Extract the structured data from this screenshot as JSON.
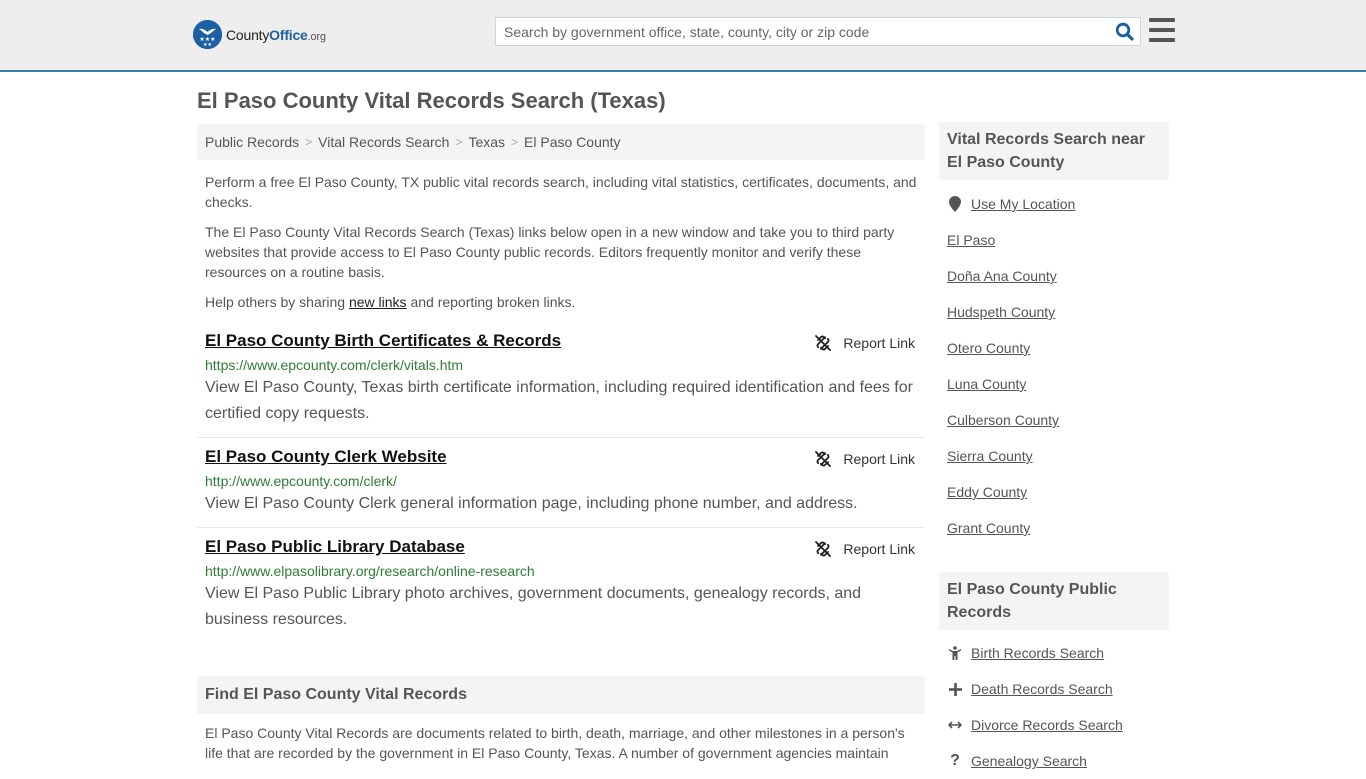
{
  "header": {
    "logo": {
      "brand_prefix": "County",
      "brand_main": "Office",
      "brand_suffix": ".org"
    },
    "search": {
      "placeholder": "Search by government office, state, county, city or zip code",
      "value": ""
    },
    "accent_color": "#3a7bb0"
  },
  "page": {
    "title": "El Paso County Vital Records Search (Texas)"
  },
  "breadcrumb": [
    {
      "label": "Public Records"
    },
    {
      "label": "Vital Records Search"
    },
    {
      "label": "Texas"
    },
    {
      "label": "El Paso County"
    }
  ],
  "intro": {
    "p1": "Perform a free El Paso County, TX public vital records search, including vital statistics, certificates, documents, and checks.",
    "p2": "The El Paso County Vital Records Search (Texas) links below open in a new window and take you to third party websites that provide access to El Paso County public records. Editors frequently monitor and verify these resources on a routine basis.",
    "p3_before": "Help others by sharing ",
    "p3_link": "new links",
    "p3_after": " and reporting broken links."
  },
  "results": [
    {
      "title": "El Paso County Birth Certificates & Records",
      "url": "https://www.epcounty.com/clerk/vitals.htm",
      "description": "View El Paso County, Texas birth certificate information, including required identification and fees for certified copy requests.",
      "report_label": "Report Link"
    },
    {
      "title": "El Paso County Clerk Website",
      "url": "http://www.epcounty.com/clerk/",
      "description": "View El Paso County Clerk general information page, including phone number, and address.",
      "report_label": "Report Link"
    },
    {
      "title": "El Paso Public Library Database",
      "url": "http://www.elpasolibrary.org/research/online-research",
      "description": "View El Paso Public Library photo archives, government documents, genealogy records, and business resources.",
      "report_label": "Report Link"
    }
  ],
  "find_section": {
    "heading": "Find El Paso County Vital Records",
    "body": "El Paso County Vital Records are documents related to birth, death, marriage, and other milestones in a person's life that are recorded by the government in El Paso County, Texas. A number of government agencies maintain"
  },
  "sidebar": {
    "nearby": {
      "heading": "Vital Records Search near El Paso County",
      "use_location": "Use My Location",
      "items": [
        "El Paso",
        "Doña Ana County",
        "Hudspeth County",
        "Otero County",
        "Luna County",
        "Culberson County",
        "Sierra County",
        "Eddy County",
        "Grant County"
      ]
    },
    "public_records": {
      "heading": "El Paso County Public Records",
      "items": [
        {
          "label": "Birth Records Search",
          "icon": "child-icon"
        },
        {
          "label": "Death Records Search",
          "icon": "cross-icon"
        },
        {
          "label": "Divorce Records Search",
          "icon": "arrows-horizontal-icon"
        },
        {
          "label": "Genealogy Search",
          "icon": "question-icon"
        }
      ]
    }
  }
}
